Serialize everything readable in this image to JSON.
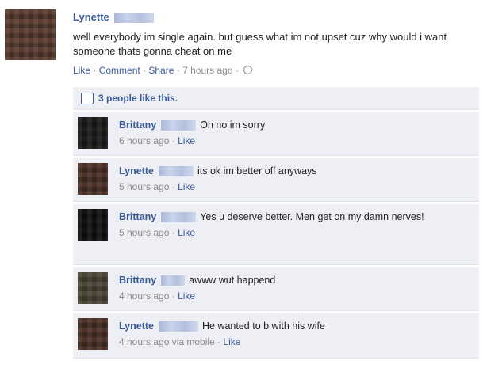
{
  "post": {
    "author": "Lynette",
    "text": "well everybody im single again. but guess what im not upset cuz why would i want someone thats gonna cheat on me",
    "actions": {
      "like": "Like",
      "comment": "Comment",
      "share": "Share",
      "time": "7 hours ago"
    },
    "likes": "3 people like this."
  },
  "comments": [
    {
      "author": "Brittany",
      "text": "Oh no im sorry",
      "time": "6 hours ago",
      "like": "Like"
    },
    {
      "author": "Lynette",
      "text": "its ok im better off anyways",
      "time": "5 hours ago",
      "like": "Like"
    },
    {
      "author": "Brittany",
      "text": "Yes u deserve better. Men get on my damn nerves!",
      "time": "5 hours ago",
      "like": "Like"
    },
    {
      "author": "Brittany",
      "text": "awww wut happend",
      "time": "4 hours ago",
      "like": "Like"
    },
    {
      "author": "Lynette",
      "text": "He wanted to b with his wife",
      "time": "4 hours ago via mobile",
      "like": "Like"
    }
  ],
  "colors": {
    "link": "#3b5998",
    "meta": "#8b8b8b",
    "comment_bg": "#edeff4"
  }
}
